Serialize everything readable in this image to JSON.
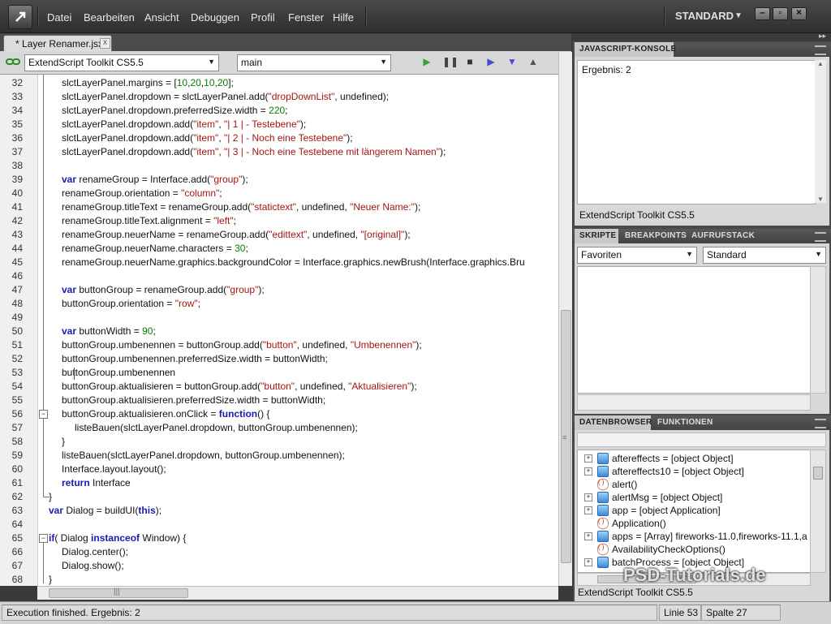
{
  "menubar": {
    "items": [
      "Datei",
      "Bearbeiten",
      "Ansicht",
      "Debuggen",
      "Profil",
      "Fenster",
      "Hilfe"
    ],
    "workspace": "STANDARD"
  },
  "document_tab": {
    "title": "* Layer Renamer.jsx",
    "close_glyph": "x"
  },
  "toolbar": {
    "target": "ExtendScript Toolkit CS5.5",
    "engine": "main"
  },
  "editor": {
    "lines": [
      {
        "n": "32"
      },
      {
        "n": "33"
      },
      {
        "n": "34"
      },
      {
        "n": "35"
      },
      {
        "n": "36"
      },
      {
        "n": "37"
      },
      {
        "n": "38"
      },
      {
        "n": "39"
      },
      {
        "n": "40"
      },
      {
        "n": "41"
      },
      {
        "n": "42"
      },
      {
        "n": "43"
      },
      {
        "n": "44"
      },
      {
        "n": "45"
      },
      {
        "n": "46"
      },
      {
        "n": "47"
      },
      {
        "n": "48"
      },
      {
        "n": "49"
      },
      {
        "n": "50"
      },
      {
        "n": "51"
      },
      {
        "n": "52"
      },
      {
        "n": "53"
      },
      {
        "n": "54"
      },
      {
        "n": "55"
      },
      {
        "n": "56"
      },
      {
        "n": "57"
      },
      {
        "n": "58"
      },
      {
        "n": "59"
      },
      {
        "n": "60"
      },
      {
        "n": "61"
      },
      {
        "n": "62"
      },
      {
        "n": "63"
      },
      {
        "n": "64"
      },
      {
        "n": "65"
      },
      {
        "n": "66"
      },
      {
        "n": "67"
      },
      {
        "n": "68"
      }
    ],
    "code": {
      "l32a": "slctLayerPanel.margins = [",
      "l32b": "10",
      "l32c": ",",
      "l32d": "20",
      "l32e": ",",
      "l32f": "10",
      "l32g": ",",
      "l32h": "20",
      "l32i": "];",
      "l33a": "slctLayerPanel.dropdown = slctLayerPanel.add(",
      "l33b": "\"dropDownList\"",
      "l33c": ", undefined);",
      "l34a": "slctLayerPanel.dropdown.preferredSize.width = ",
      "l34b": "220",
      "l34c": ";",
      "l35a": "slctLayerPanel.dropdown.add(",
      "l35b": "\"item\"",
      "l35c": ", ",
      "l35d": "\"| 1 | - Testebene\"",
      "l35e": ");",
      "l36a": "slctLayerPanel.dropdown.add(",
      "l36b": "\"item\"",
      "l36c": ", ",
      "l36d": "\"| 2 | - Noch eine Testebene\"",
      "l36e": ");",
      "l37a": "slctLayerPanel.dropdown.add(",
      "l37b": "\"item\"",
      "l37c": ", ",
      "l37d": "\"| 3 | - Noch eine Testebene mit längerem Namen\"",
      "l37e": ");",
      "l39a": "var",
      "l39b": " renameGroup = Interface.add(",
      "l39c": "\"group\"",
      "l39d": ");",
      "l40a": "renameGroup.orientation = ",
      "l40b": "\"column\"",
      "l40c": ";",
      "l41a": "renameGroup.titleText = renameGroup.add(",
      "l41b": "\"statictext\"",
      "l41c": ", undefined, ",
      "l41d": "\"Neuer Name:\"",
      "l41e": ");",
      "l42a": "renameGroup.titleText.alignment = ",
      "l42b": "\"left\"",
      "l42c": ";",
      "l43a": "renameGroup.neuerName = renameGroup.add(",
      "l43b": "\"edittext\"",
      "l43c": ", undefined, ",
      "l43d": "\"[original]\"",
      "l43e": ");",
      "l44a": "renameGroup.neuerName.characters = ",
      "l44b": "30",
      "l44c": ";",
      "l45a": "renameGroup.neuerName.graphics.backgroundColor = Interface.graphics.newBrush(Interface.graphics.Bru",
      "l47a": "var",
      "l47b": " buttonGroup = renameGroup.add(",
      "l47c": "\"group\"",
      "l47d": ");",
      "l48a": "buttonGroup.orientation = ",
      "l48b": "\"row\"",
      "l48c": ";",
      "l50a": "var",
      "l50b": " buttonWidth = ",
      "l50c": "90",
      "l50d": ";",
      "l51a": "buttonGroup.umbenennen = buttonGroup.add(",
      "l51b": "\"button\"",
      "l51c": ", undefined, ",
      "l51d": "\"Umbenennen\"",
      "l51e": ");",
      "l52a": "buttonGroup.umbenennen.preferredSize.width = buttonWidth;",
      "l53a": "buttonGroup.umbenennen",
      "l54a": "buttonGroup.aktualisieren = buttonGroup.add(",
      "l54b": "\"button\"",
      "l54c": ", undefined, ",
      "l54d": "\"Aktualisieren\"",
      "l54e": ");",
      "l55a": "buttonGroup.aktualisieren.preferredSize.width = buttonWidth;",
      "l56a": "buttonGroup.aktualisieren.onClick = ",
      "l56b": "function",
      "l56c": "() {",
      "l57a": "listeBauen(slctLayerPanel.dropdown, buttonGroup.umbenennen);",
      "l58a": "}",
      "l59a": "listeBauen(slctLayerPanel.dropdown, buttonGroup.umbenennen);",
      "l60a": "Interface.layout.layout();",
      "l61a": "return",
      "l61b": " Interface",
      "l62a": "}",
      "l63a": "var",
      "l63b": " Dialog = buildUI(",
      "l63c": "this",
      "l63d": ");",
      "l65a": "if",
      "l65b": "( Dialog ",
      "l65c": "instanceof",
      "l65d": " Window) {",
      "l66a": "Dialog.center();",
      "l67a": "Dialog.show();",
      "l68a": "}"
    }
  },
  "console": {
    "title": "JAVASCRIPT-KONSOLE",
    "output": "Ergebnis: 2",
    "footer": "ExtendScript Toolkit CS5.5"
  },
  "scripts_panel": {
    "tabs": [
      "SKRIPTE",
      "BREAKPOINTS",
      "AUFRUFSTACK"
    ],
    "left_select": "Favoriten",
    "right_select": "Standard"
  },
  "data_browser": {
    "tabs": [
      "DATENBROWSER",
      "FUNKTIONEN"
    ],
    "items": [
      {
        "label": "aftereffects = [object Object]",
        "icon": "object-icon",
        "expand": true
      },
      {
        "label": "aftereffects10 = [object Object]",
        "icon": "object-icon",
        "expand": true
      },
      {
        "label": "alert()",
        "icon": "function-icon",
        "expand": false
      },
      {
        "label": "alertMsg = [object Object]",
        "icon": "object-icon",
        "expand": true
      },
      {
        "label": "app = [object Application]",
        "icon": "object-icon",
        "expand": true
      },
      {
        "label": "Application()",
        "icon": "function-icon",
        "expand": false
      },
      {
        "label": "apps = [Array] fireworks-11.0,fireworks-11.1,a",
        "icon": "object-icon",
        "expand": true
      },
      {
        "label": "AvailabilityCheckOptions()",
        "icon": "function-icon",
        "expand": false
      },
      {
        "label": "batchProcess = [object Object]",
        "icon": "object-icon",
        "expand": true
      }
    ],
    "footer": "ExtendScript Toolkit CS5.5",
    "watermark": "PSD-Tutorials.de"
  },
  "status": {
    "message": "Execution finished. Ergebnis: 2",
    "line": "Linie 53",
    "column": "Spalte 27"
  },
  "colors": {
    "keyword": "#1a1ab0",
    "string": "#a31515",
    "number": "#0a7a0a",
    "accent_play": "#3aa23a",
    "accent_step": "#4a4ad0"
  }
}
